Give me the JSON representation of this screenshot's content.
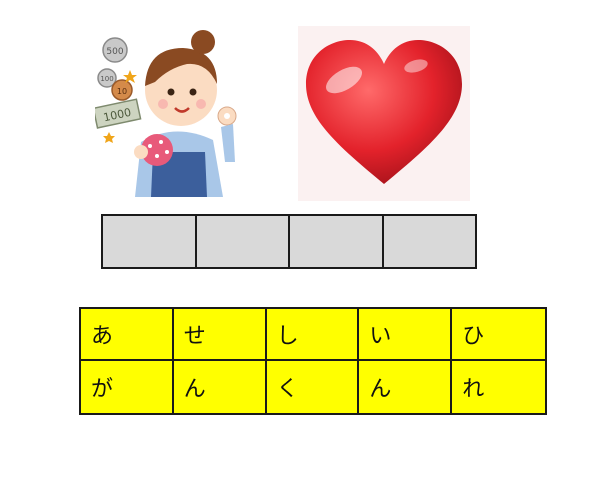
{
  "images": {
    "left": {
      "icon": "woman-with-money-icon",
      "coin_labels": [
        "500",
        "100",
        "10",
        "1000"
      ]
    },
    "right": {
      "icon": "heart-icon"
    }
  },
  "answer_slots": [
    "",
    "",
    "",
    ""
  ],
  "kana_grid": {
    "rows": [
      [
        "あ",
        "せ",
        "し",
        "い",
        "ひ"
      ],
      [
        "が",
        "ん",
        "く",
        "ん",
        "れ"
      ]
    ]
  },
  "colors": {
    "grid_background": "#ffff00",
    "slot_background": "#d9d9d9",
    "heart": "#e3222b"
  }
}
